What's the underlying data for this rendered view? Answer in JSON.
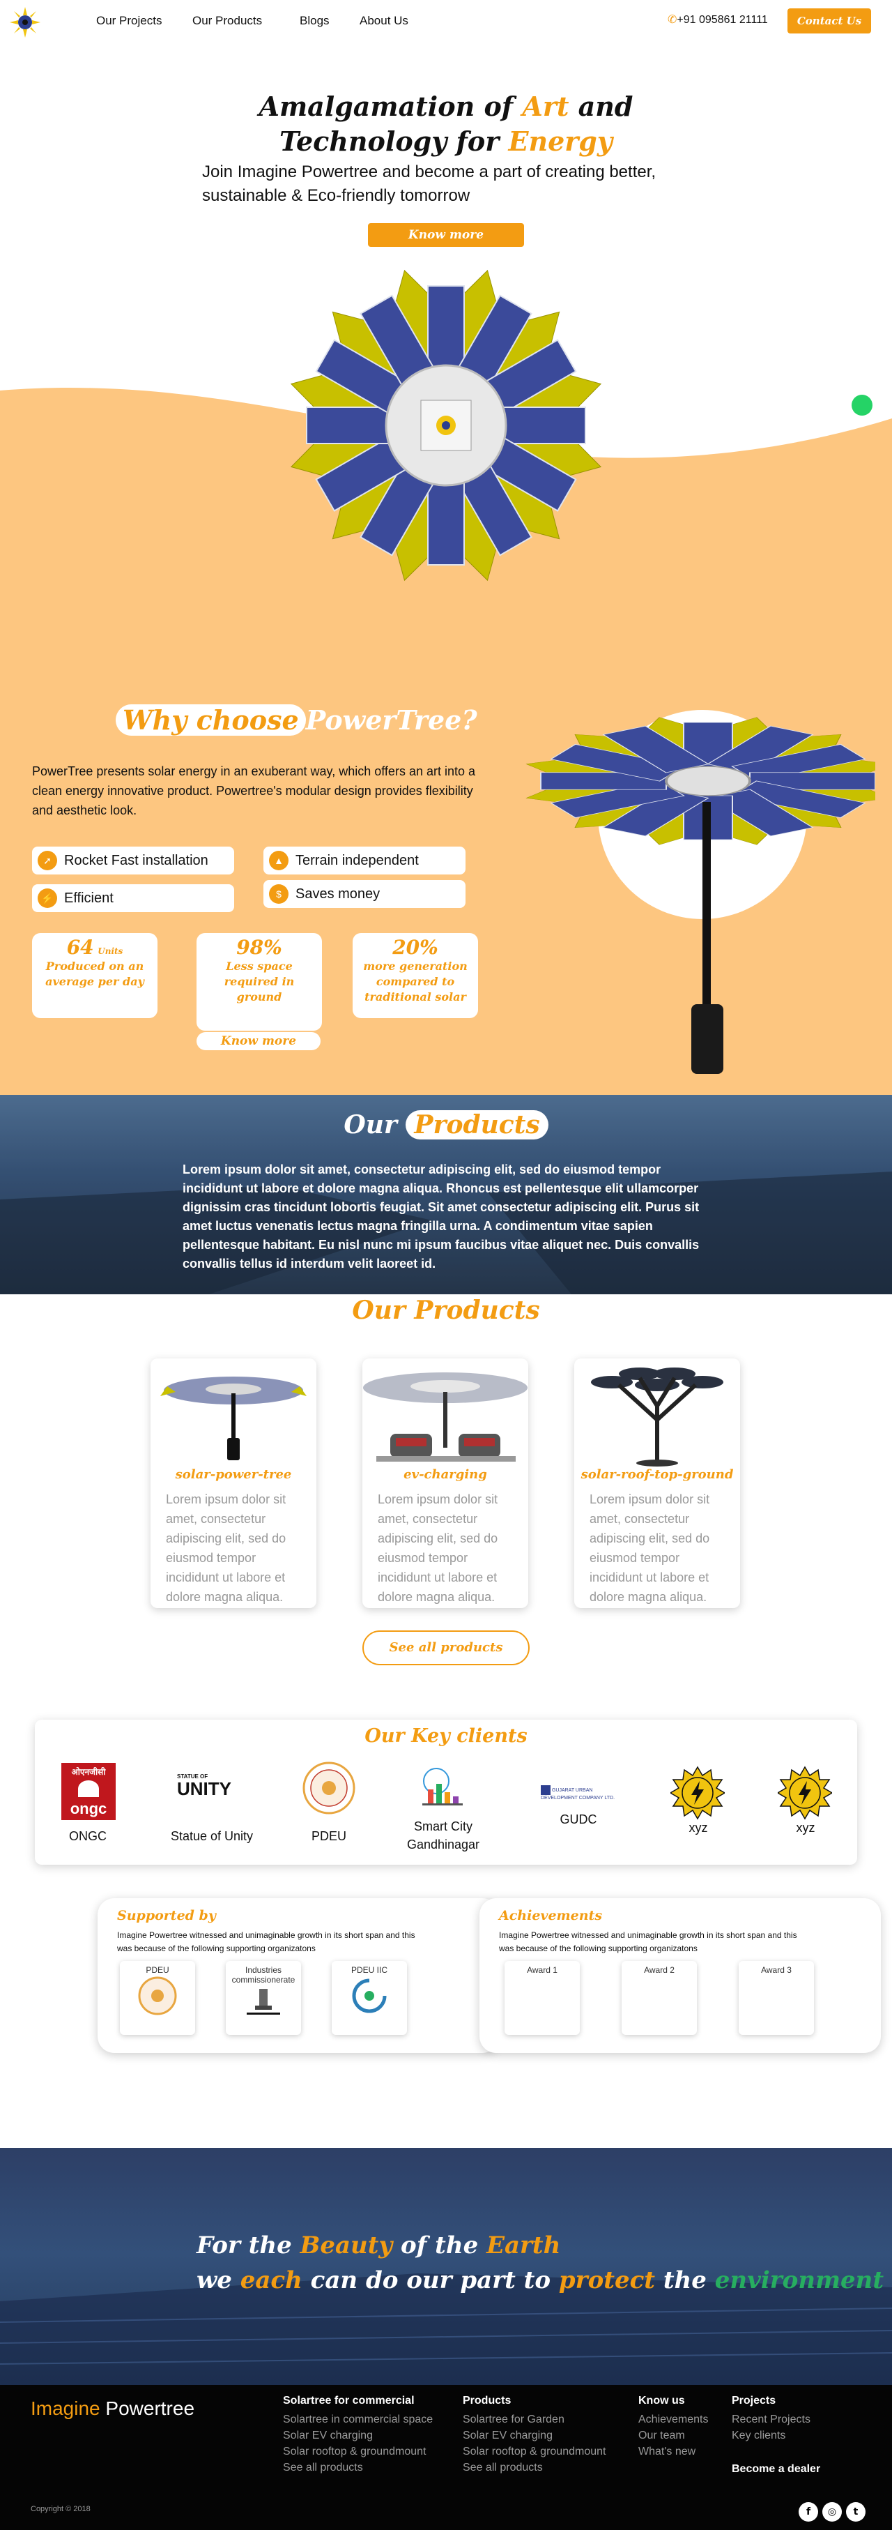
{
  "nav": {
    "links": [
      "Our Projects",
      "Our Products",
      "Blogs",
      "About Us"
    ],
    "phone": "+91 095861 21111",
    "contact_label": "Contact Us"
  },
  "hero": {
    "title_line1_a": "Amalgamation of ",
    "title_line1_b": "Art",
    "title_line1_c": " and",
    "title_line2_a": "Technology for ",
    "title_line2_b": "Energy",
    "subtitle": "Join Imagine Powertree  and become a part of creating better, sustainable & Eco-friendly tomorrow",
    "cta": "Know more"
  },
  "why": {
    "title_a": "Why choose",
    "title_b": "PowerTree?",
    "desc": "PowerTree presents solar energy in an exuberant way, which offers an art into a clean energy innovative product. Powertree's modular design provides flexibility and aesthetic look.",
    "features": [
      "Rocket Fast installation",
      "Terrain independent",
      "Efficient",
      "Saves money"
    ],
    "stats": [
      {
        "num": "64",
        "unit": "Units",
        "text": "Produced on an average per day"
      },
      {
        "num": "98%",
        "unit": "",
        "text": "Less space required in ground"
      },
      {
        "num": "20%",
        "unit": "",
        "text": "more generation compared to traditional solar"
      }
    ],
    "cta": "Know more"
  },
  "banner": {
    "title_a": "Our",
    "title_b": "Products",
    "text": "Lorem ipsum dolor sit amet, consectetur adipiscing elit, sed do eiusmod tempor incididunt ut labore et dolore magna aliqua. Rhoncus est pellentesque elit ullamcorper dignissim cras tincidunt lobortis feugiat. Sit amet consectetur adipiscing elit. Purus sit amet luctus venenatis lectus magna fringilla urna. A condimentum vitae sapien pellentesque habitant. Eu nisl nunc mi ipsum faucibus vitae aliquet nec. Duis convallis convallis tellus id interdum velit laoreet id."
  },
  "products": {
    "heading": "Our Products",
    "items": [
      {
        "name": "solar-power-tree",
        "body": "Lorem ipsum dolor sit amet, consectetur adipiscing elit, sed do eiusmod tempor incididunt ut labore et dolore magna aliqua."
      },
      {
        "name": "ev-charging",
        "body": "Lorem ipsum dolor sit amet, consectetur adipiscing elit, sed do eiusmod tempor incididunt ut labore et dolore magna aliqua."
      },
      {
        "name": "solar-roof-top-ground",
        "body": "Lorem ipsum dolor sit amet, consectetur adipiscing elit, sed do eiusmod tempor incididunt ut labore et dolore magna aliqua."
      }
    ],
    "see_all": "See all products"
  },
  "clients": {
    "title": "Our Key clients",
    "items": [
      "ONGC",
      "Statue of Unity",
      "PDEU",
      "Smart City Gandhinagar",
      "GUDC",
      "xyz",
      "xyz"
    ],
    "logo_text": {
      "ongc_hi": "ओएनजीसी",
      "ongc": "ongc",
      "unity_top": "STATUE OF",
      "unity": "UNITY",
      "gudc": "GUJARAT URBAN DEVELOPMENT COMPANY LTD."
    }
  },
  "supported": {
    "title": "Supported by",
    "body": "Imagine Powertree witnessed and unimaginable growth in its short span and this was because of the following supporting organizatons",
    "items": [
      "PDEU",
      "Industries commissionerate",
      "PDEU IIC"
    ]
  },
  "achievements": {
    "title": "Achievements",
    "body": "Imagine Powertree witnessed and unimaginable growth in its short span and this was because of the following supporting organizatons",
    "items": [
      "Award 1",
      "Award 2",
      "Award 3"
    ]
  },
  "earth": {
    "l1a": "For the ",
    "l1b": "Beauty",
    "l1c": " of the ",
    "l1d": "Earth",
    "l2a": "we ",
    "l2b": "each",
    "l2c": " can do our part to ",
    "l2d": "protect",
    "l2e": " the ",
    "l2f": "environment"
  },
  "footer": {
    "brand_a": "Imagine",
    "brand_b": " Powertree",
    "cols": [
      {
        "h": "Solartree for commercial",
        "items": [
          "Solartree in commercial space",
          "Solar EV charging",
          "Solar rooftop & groundmount",
          "See all products"
        ]
      },
      {
        "h": "Products",
        "items": [
          "Solartree for Garden",
          "Solar EV charging",
          "Solar rooftop & groundmount",
          "See all products"
        ]
      },
      {
        "h": "Know us",
        "items": [
          "Achievements",
          "Our team",
          "What's new"
        ]
      },
      {
        "h": "Projects",
        "items": [
          "Recent Projects",
          "Key clients"
        ]
      }
    ],
    "become": "Become a dealer",
    "copyright": "Copyright © 2018",
    "social": [
      "f",
      "◎",
      "t"
    ]
  },
  "colors": {
    "accent": "#f39c12",
    "peach": "#fdc680",
    "dark": "#050505",
    "green": "#27ae60"
  }
}
